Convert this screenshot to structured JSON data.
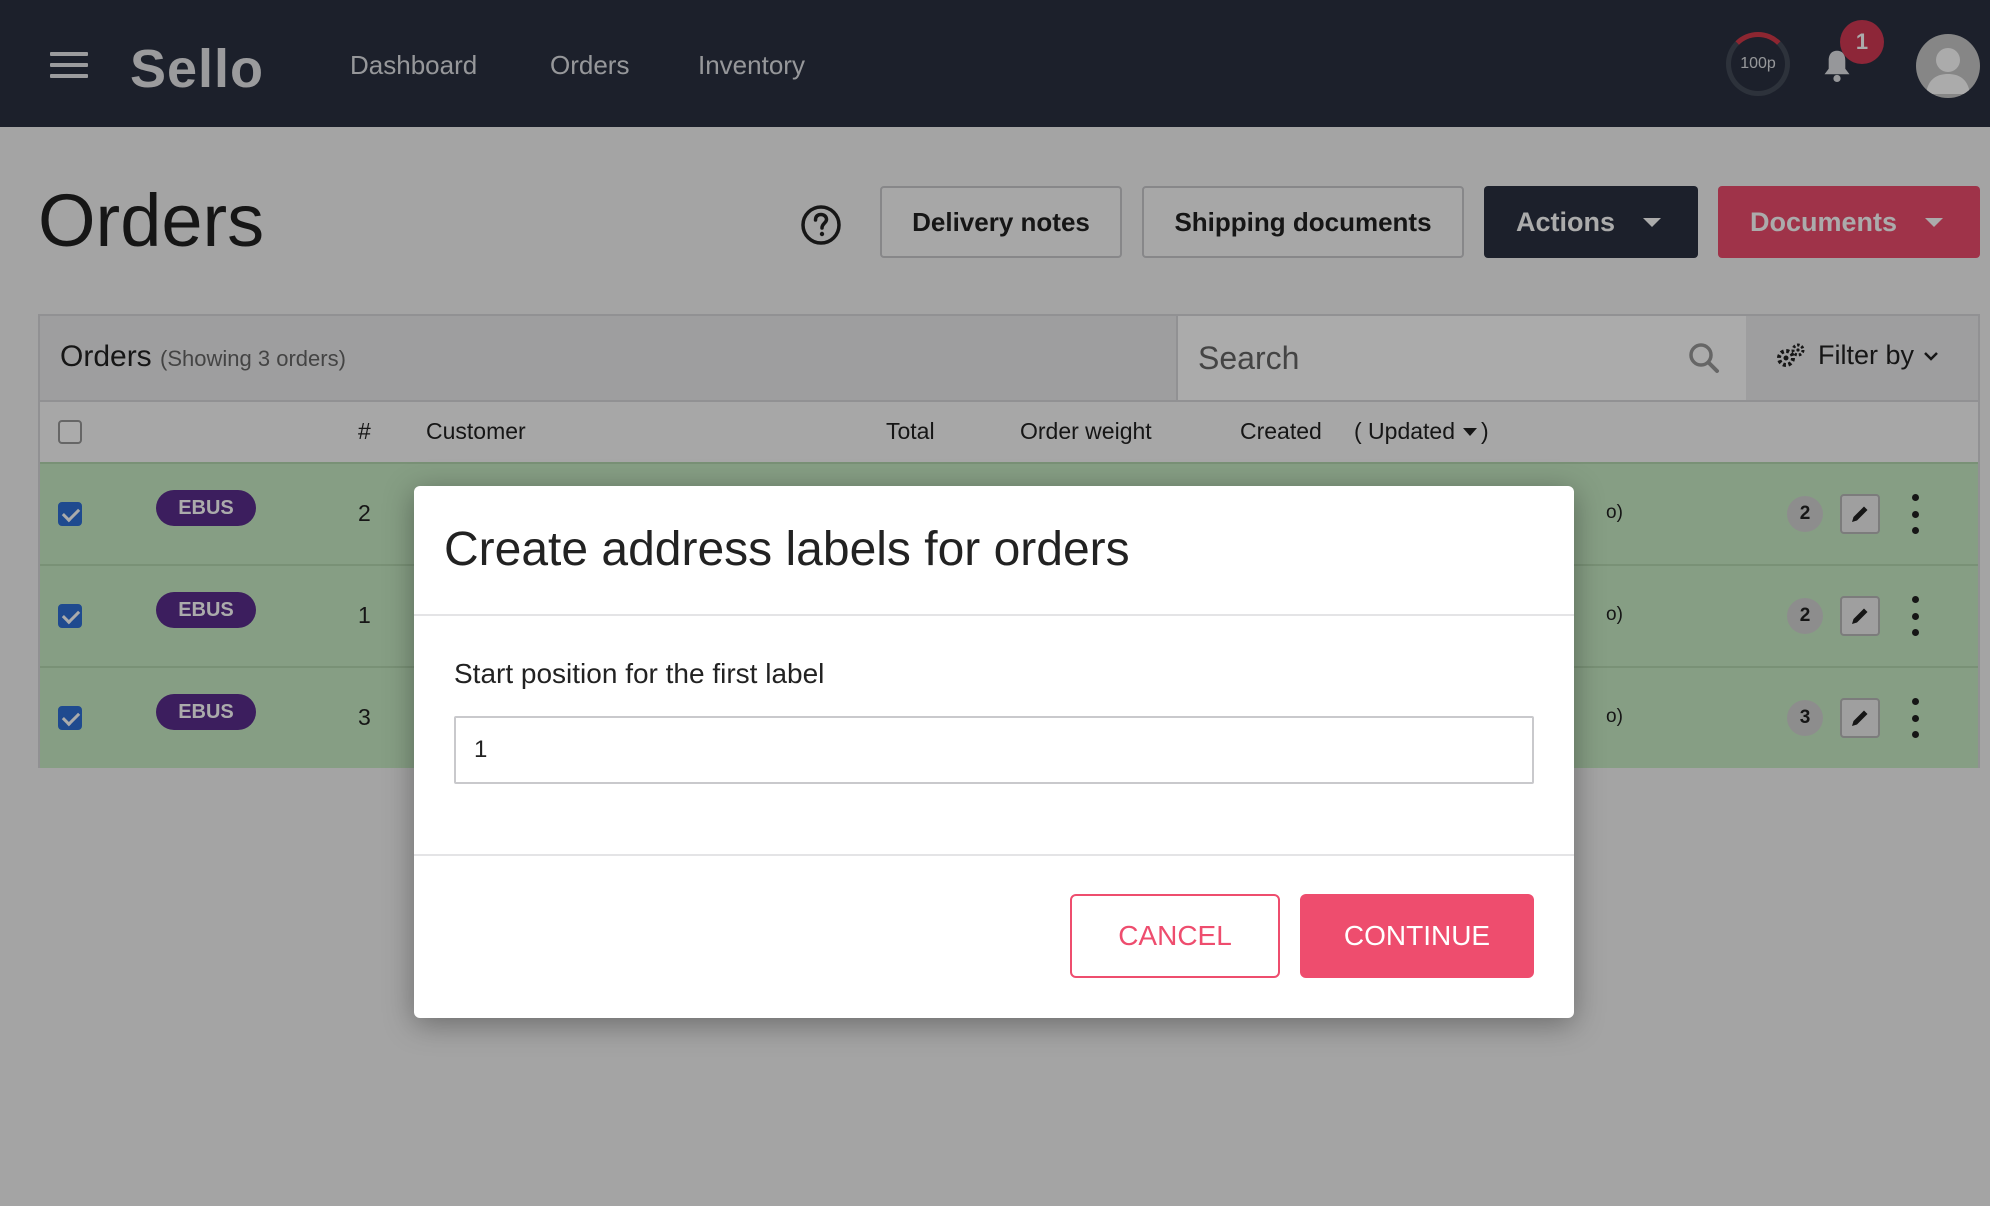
{
  "app": {
    "logo": "Sello"
  },
  "nav": {
    "links": [
      "Dashboard",
      "Orders",
      "Inventory"
    ]
  },
  "header": {
    "credits": "100p",
    "notifications": "1"
  },
  "page": {
    "title": "Orders"
  },
  "toolbar": {
    "delivery_notes": "Delivery notes",
    "shipping_documents": "Shipping documents",
    "actions": "Actions",
    "documents": "Documents"
  },
  "panel": {
    "title": "Orders",
    "subtitle": "(Showing 3 orders)",
    "search_placeholder": "Search",
    "filter": "Filter by"
  },
  "columns": {
    "number": "#",
    "customer": "Customer",
    "total": "Total",
    "weight": "Order weight",
    "created": "Created",
    "updated": "( Updated"
  },
  "rows": [
    {
      "badge": "EBUS",
      "number": "2",
      "trail": "o)",
      "count": "2",
      "checked": true
    },
    {
      "badge": "EBUS",
      "number": "1",
      "trail": "o)",
      "count": "2",
      "checked": true
    },
    {
      "badge": "EBUS",
      "number": "3",
      "trail": "o)",
      "count": "3",
      "checked": true
    }
  ],
  "modal": {
    "title": "Create address labels for orders",
    "field_label": "Start position for the first label",
    "field_value": "1",
    "cancel": "CANCEL",
    "continue": "CONTINUE"
  },
  "colors": {
    "topbar": "#2a3140",
    "accent": "#ee4d6e",
    "row_selected": "#c8ecc5",
    "badge": "#5a2d8c"
  }
}
